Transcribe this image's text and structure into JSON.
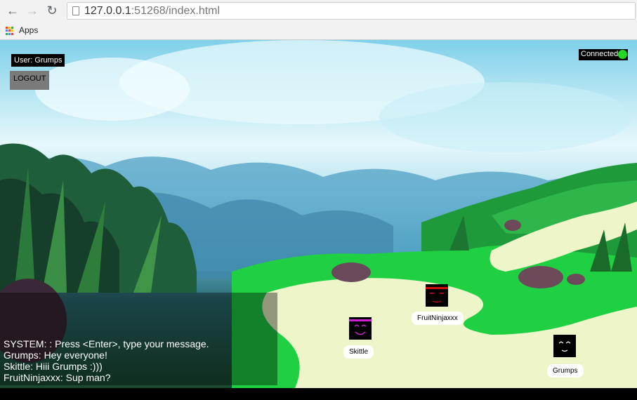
{
  "browser": {
    "address_host": "127.0.0.1",
    "address_rest": ":51268/index.html",
    "bookmarks_label": "Apps",
    "back_icon": "back-arrow-icon",
    "forward_icon": "forward-arrow-icon",
    "reload_icon": "reload-icon"
  },
  "game": {
    "user_label": "User: Grumps",
    "logout_label": "LOGOUT",
    "connection_status": "Connected",
    "status_color": "#22d822",
    "chat": [
      "SYSTEM: : Press <Enter>, type your message.",
      "Grumps: Hey everyone!",
      "Skittle: Hiii Grumps :)))",
      "FruitNinjaxxx: Sup man?"
    ],
    "players": [
      {
        "name": "FruitNinjaxxx",
        "accent": "#d01010"
      },
      {
        "name": "Skittle",
        "accent": "#d020d0"
      },
      {
        "name": "Grumps",
        "accent": "#ffffff"
      }
    ]
  }
}
